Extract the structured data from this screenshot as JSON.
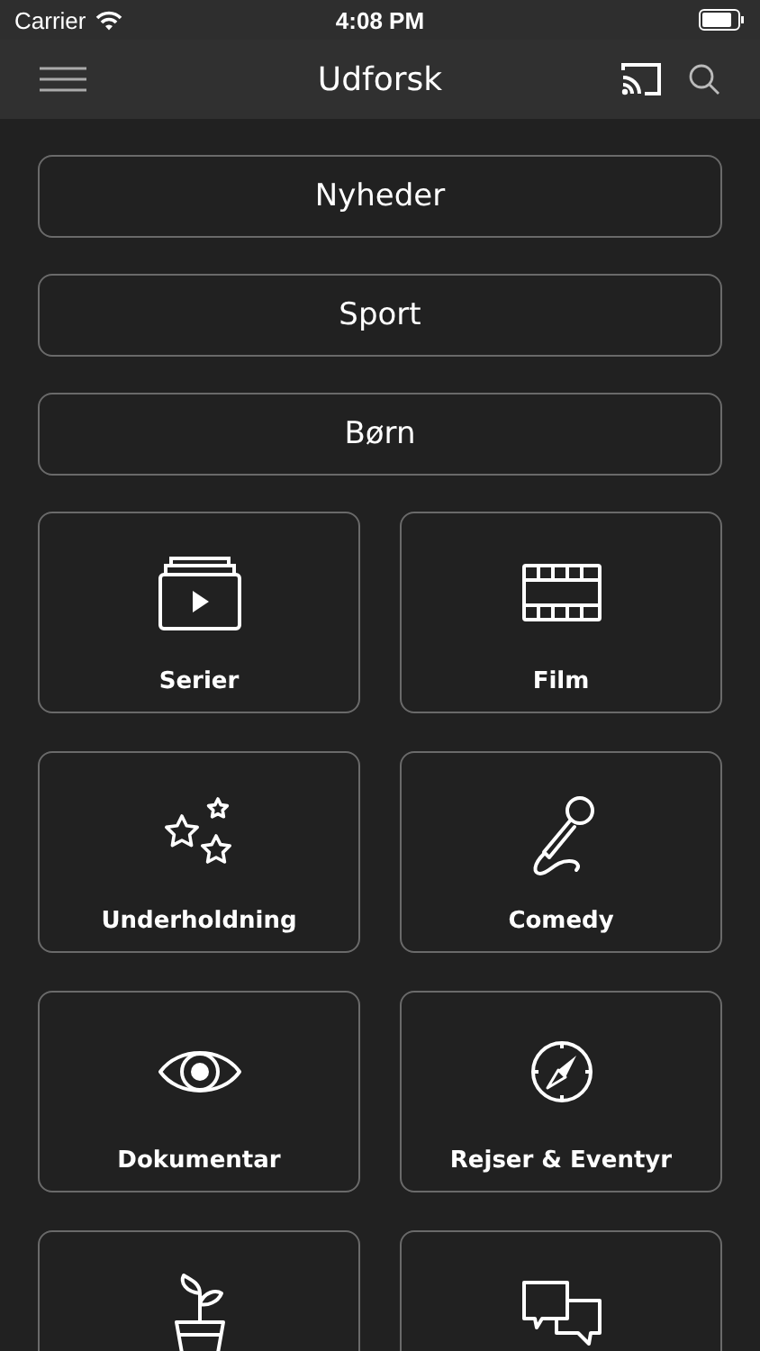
{
  "status_bar": {
    "carrier": "Carrier",
    "time": "4:08 PM"
  },
  "nav_bar": {
    "title": "Udforsk"
  },
  "categories": [
    {
      "label": "Nyheder"
    },
    {
      "label": "Sport"
    },
    {
      "label": "Børn"
    }
  ],
  "tiles": [
    {
      "kind": "labeled",
      "label": "Serier"
    },
    {
      "kind": "labeled",
      "label": "Film"
    },
    {
      "kind": "labeled",
      "label": "Underholdning"
    },
    {
      "kind": "labeled",
      "label": "Comedy"
    },
    {
      "kind": "labeled",
      "label": "Dokumentar"
    },
    {
      "kind": "labeled",
      "label": "Rejser & Eventyr"
    },
    {
      "kind": "icon_only"
    },
    {
      "kind": "icon_only"
    }
  ]
}
